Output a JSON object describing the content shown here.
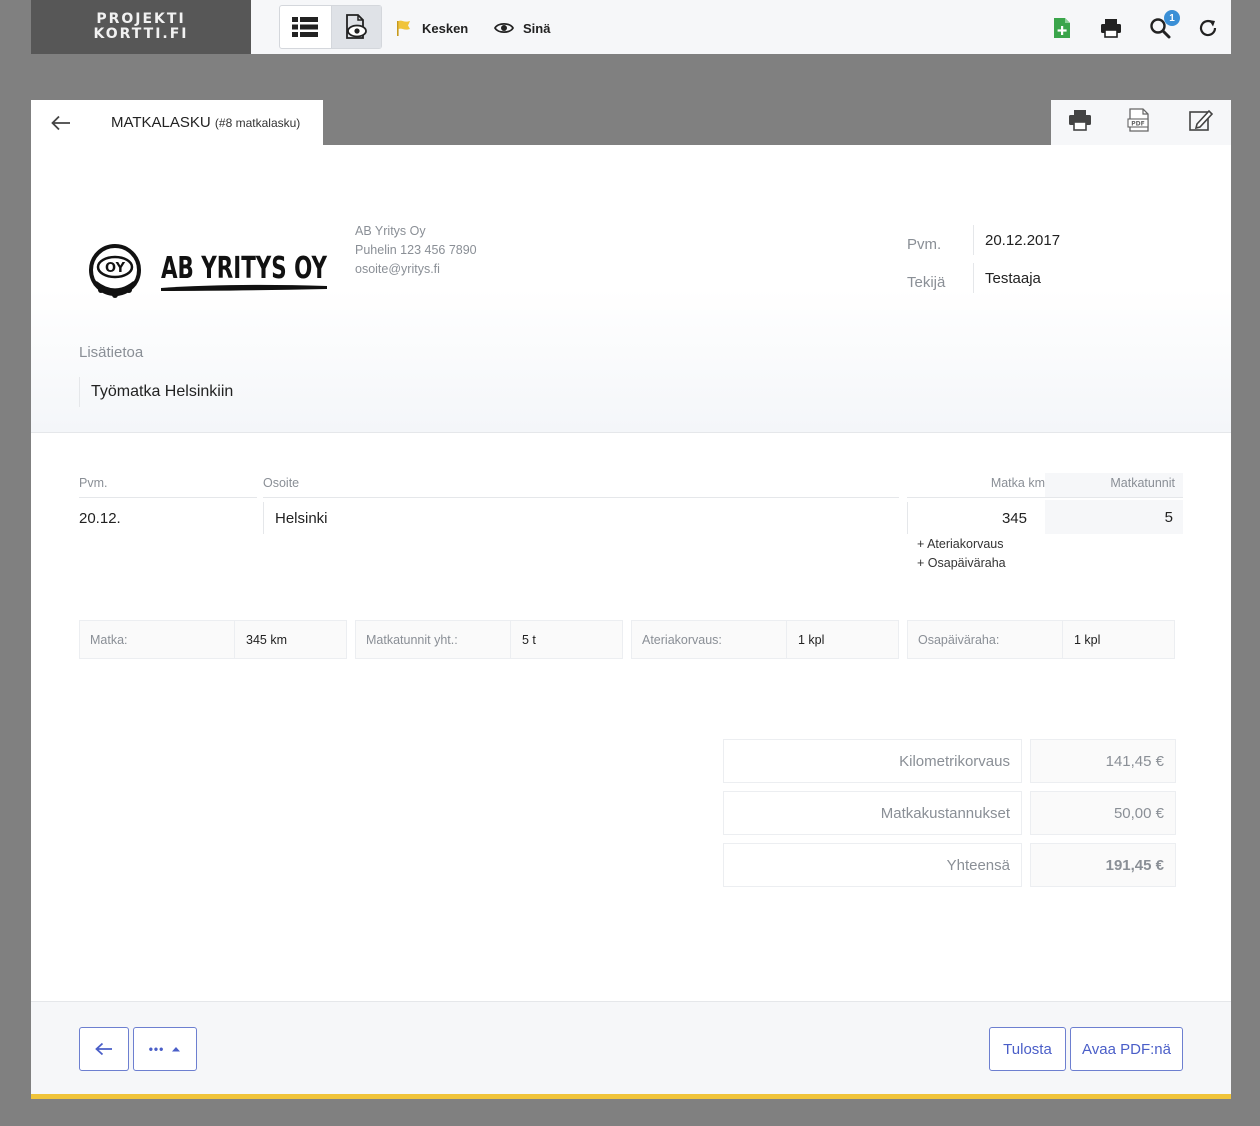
{
  "brand": {
    "line1": "PROJEKTI",
    "line2": "KORTTI.FI"
  },
  "topbar": {
    "status_label": "Kesken",
    "visibility_label": "Sinä",
    "notification_count": "1",
    "colors": {
      "flag": "#f0c43a",
      "add": "#3aa54b",
      "badge": "#3a8fd6"
    }
  },
  "tab": {
    "title": "MATKALASKU",
    "subtitle": "(#8 matkalasku)"
  },
  "company": {
    "logo_text": "AB YRITYS OY",
    "logo_badge": "OY",
    "name": "AB Yritys Oy",
    "phone": "Puhelin 123 456 7890",
    "email": "osoite@yritys.fi"
  },
  "meta": {
    "date_label": "Pvm.",
    "date_value": "20.12.2017",
    "author_label": "Tekijä",
    "author_value": "Testaaja"
  },
  "extra": {
    "label": "Lisätietoa",
    "value": "Työmatka Helsinkiin"
  },
  "trip_table": {
    "headers": {
      "date": "Pvm.",
      "address": "Osoite",
      "km": "Matka km",
      "hours": "Matkatunnit"
    },
    "rows": [
      {
        "date": "20.12.",
        "address": "Helsinki",
        "km": "345",
        "hours": "5",
        "addons": [
          "+ Ateriakorvaus",
          "+ Osapäiväraha"
        ]
      }
    ]
  },
  "summary": [
    {
      "label": "Matka:",
      "value": "345 km"
    },
    {
      "label": "Matkatunnit yht.:",
      "value": "5 t"
    },
    {
      "label": "Ateriakorvaus:",
      "value": "1 kpl"
    },
    {
      "label": "Osapäiväraha:",
      "value": "1 kpl"
    }
  ],
  "totals": [
    {
      "label": "Kilometrikorvaus",
      "value": "141,45 €"
    },
    {
      "label": "Matkakustannukset",
      "value": "50,00 €"
    },
    {
      "label": "Yhteensä",
      "value": "191,45 €"
    }
  ],
  "footer": {
    "more_label": "•••",
    "print_label": "Tulosta",
    "pdf_label": "Avaa PDF:nä"
  },
  "colors": {
    "accent": "#4a5ec8",
    "footer_bar": "#f0c43a"
  }
}
